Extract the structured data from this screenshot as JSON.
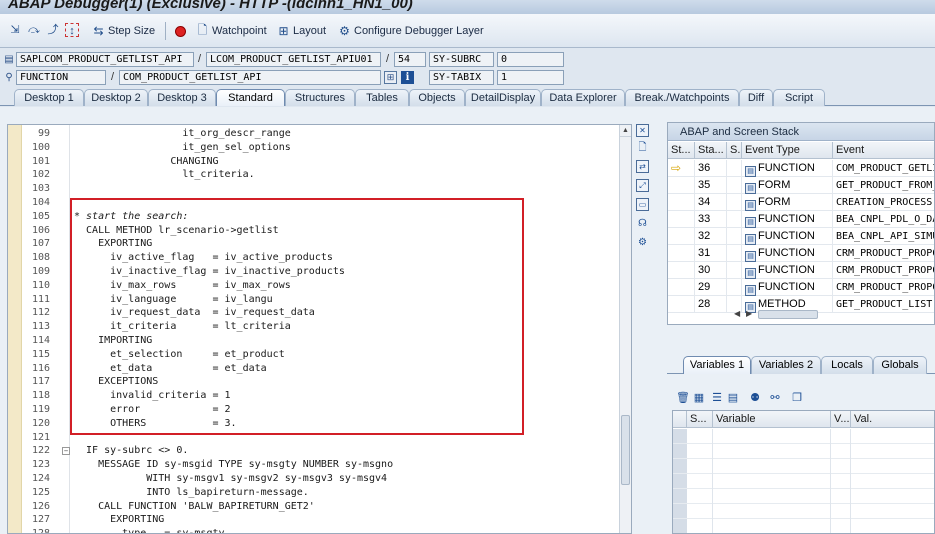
{
  "window": {
    "title": "ABAP Debugger(1)  (Exclusive) - HTTP -(ldcihn1_HN1_00)"
  },
  "toolbar": {
    "icons": [
      "step-into-icon",
      "step-over-icon",
      "step-return-icon",
      "continue-icon"
    ],
    "step_size_label": "Step Size",
    "watchpoint_label": "Watchpoint",
    "layout_label": "Layout",
    "configure_label": "Configure Debugger Layer"
  },
  "fields": {
    "program": "SAPLCOM_PRODUCT_GETLIST_API",
    "include": "LCOM_PRODUCT_GETLIST_APIU01",
    "line": "54",
    "subrc_label": "SY-SUBRC",
    "subrc_value": "0",
    "event_type": "FUNCTION",
    "event_name": "COM_PRODUCT_GETLIST_API",
    "tabix_label": "SY-TABIX",
    "tabix_value": "1"
  },
  "tabs": [
    "Desktop 1",
    "Desktop 2",
    "Desktop 3",
    "Standard",
    "Structures",
    "Tables",
    "Objects",
    "DetailDisplay",
    "Data Explorer",
    "Break./Watchpoints",
    "Diff",
    "Script"
  ],
  "active_tab": "Standard",
  "code": [
    {
      "n": "99",
      "t": "                  it_org_descr_range"
    },
    {
      "n": "100",
      "t": "                  it_gen_sel_options"
    },
    {
      "n": "101",
      "t": "                CHANGING"
    },
    {
      "n": "102",
      "t": "                  lt_criteria."
    },
    {
      "n": "103",
      "t": ""
    },
    {
      "n": "104",
      "t": ""
    },
    {
      "n": "105",
      "t": "* start the search:"
    },
    {
      "n": "106",
      "t": "  CALL METHOD lr_scenario->getlist"
    },
    {
      "n": "107",
      "t": "    EXPORTING"
    },
    {
      "n": "108",
      "t": "      iv_active_flag   = iv_active_products"
    },
    {
      "n": "109",
      "t": "      iv_inactive_flag = iv_inactive_products"
    },
    {
      "n": "110",
      "t": "      iv_max_rows      = iv_max_rows"
    },
    {
      "n": "111",
      "t": "      iv_language      = iv_langu"
    },
    {
      "n": "112",
      "t": "      iv_request_data  = iv_request_data"
    },
    {
      "n": "113",
      "t": "      it_criteria      = lt_criteria"
    },
    {
      "n": "114",
      "t": "    IMPORTING"
    },
    {
      "n": "115",
      "t": "      et_selection     = et_product"
    },
    {
      "n": "116",
      "t": "      et_data          = et_data"
    },
    {
      "n": "117",
      "t": "    EXCEPTIONS"
    },
    {
      "n": "118",
      "t": "      invalid_criteria = 1"
    },
    {
      "n": "119",
      "t": "      error            = 2"
    },
    {
      "n": "120",
      "t": "      OTHERS           = 3."
    },
    {
      "n": "121",
      "t": ""
    },
    {
      "n": "122",
      "t": "  IF sy-subrc <> 0."
    },
    {
      "n": "123",
      "t": "    MESSAGE ID sy-msgid TYPE sy-msgty NUMBER sy-msgno"
    },
    {
      "n": "124",
      "t": "            WITH sy-msgv1 sy-msgv2 sy-msgv3 sy-msgv4"
    },
    {
      "n": "125",
      "t": "            INTO ls_bapireturn-message."
    },
    {
      "n": "126",
      "t": "    CALL FUNCTION 'BALW_BAPIRETURN_GET2'"
    },
    {
      "n": "127",
      "t": "      EXPORTING"
    },
    {
      "n": "128",
      "t": "        type   = sy-msgty"
    }
  ],
  "stack": {
    "title": "ABAP and Screen Stack",
    "columns": [
      "St...",
      "Sta...",
      "S...",
      "Event Type",
      "Event"
    ],
    "rows": [
      {
        "level": "36",
        "type": "FUNCTION",
        "event": "COM_PRODUCT_GETLIST_API",
        "current": true
      },
      {
        "level": "35",
        "type": "FORM",
        "event": "GET_PRODUCT_FROM_DB"
      },
      {
        "level": "34",
        "type": "FORM",
        "event": "CREATION_PROCESS"
      },
      {
        "level": "33",
        "type": "FUNCTION",
        "event": "BEA_CNPL_PDL_O_DATA"
      },
      {
        "level": "32",
        "type": "FUNCTION",
        "event": "BEA_CNPL_API_SIMULATE"
      },
      {
        "level": "31",
        "type": "FUNCTION",
        "event": "CRM_PRODUCT_PROPOSAL"
      },
      {
        "level": "30",
        "type": "FUNCTION",
        "event": "CRM_PRODUCT_PROPOSAL"
      },
      {
        "level": "29",
        "type": "FUNCTION",
        "event": "CRM_PRODUCT_PROPOSAL"
      },
      {
        "level": "28",
        "type": "METHOD",
        "event": "GET_PRODUCT_LIST"
      }
    ]
  },
  "var_tabs": [
    "Variables 1",
    "Variables 2",
    "Locals",
    "Globals"
  ],
  "active_var_tab": "Variables 1",
  "vars": {
    "columns": [
      "S...",
      "Variable",
      "V...",
      "Val."
    ]
  },
  "colors": {
    "highlight_box": "#d21f26",
    "keyword": "#1030a0",
    "comment": "#7a8a99"
  }
}
